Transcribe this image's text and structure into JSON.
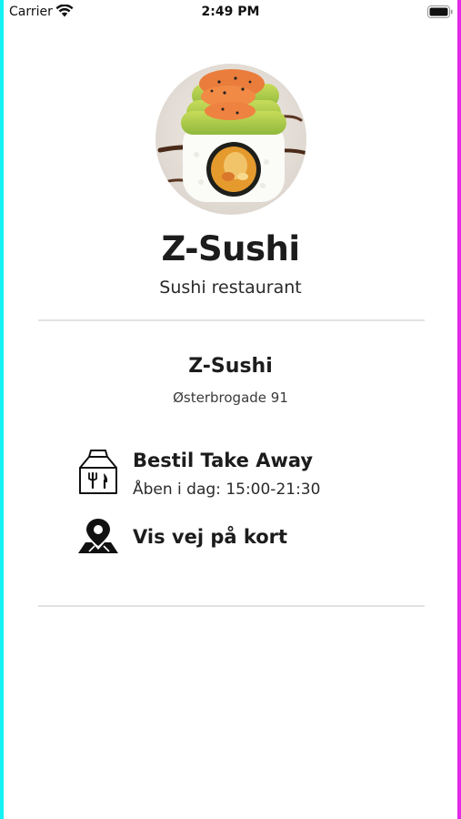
{
  "status_bar": {
    "carrier": "Carrier",
    "time": "2:49 PM",
    "icons": [
      "wifi-icon",
      "battery-icon"
    ]
  },
  "header": {
    "avatar_icon": "sushi-roll-photo",
    "title": "Z-Sushi",
    "subtitle": "Sushi restaurant"
  },
  "location": {
    "name": "Z-Sushi",
    "address": "Østerbrogade 91"
  },
  "actions": {
    "takeaway": {
      "icon": "takeaway-bag-icon",
      "label": "Bestil Take Away",
      "hours": "Åben i dag: 15:00-21:30",
      "chevron": "›"
    },
    "map": {
      "icon": "map-pin-icon",
      "label": "Vis vej på kort",
      "chevron": "›"
    }
  },
  "colors": {
    "edge_left": "#12f1f4",
    "edge_right": "#e22ae8",
    "text": "#1c1c1c",
    "divider": "#e2e2e2"
  }
}
